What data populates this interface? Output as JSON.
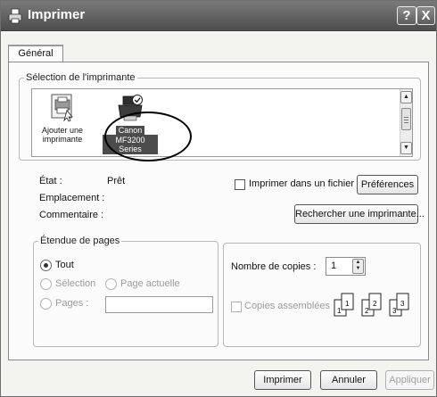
{
  "window": {
    "title": "Imprimer",
    "help_label": "?",
    "close_label": "X"
  },
  "tabs": [
    {
      "label": "Général",
      "selected": true
    }
  ],
  "printer_group": {
    "legend": "Sélection de l'imprimante",
    "items": [
      {
        "line1": "Ajouter une",
        "line2": "imprimante",
        "icon": "add-printer-icon"
      },
      {
        "line1": "Canon",
        "line2": "MF3200 Series",
        "icon": "printer-icon",
        "selected": true
      }
    ]
  },
  "info": {
    "status_label": "État :",
    "status_value": "Prêt",
    "location_label": "Emplacement :",
    "comment_label": "Commentaire :",
    "print_to_file_label": "Imprimer dans un fichier",
    "print_to_file_checked": false,
    "preferences_label": "Préférences",
    "find_printer_label": "Rechercher une imprimante..."
  },
  "page_range": {
    "legend": "Étendue de pages",
    "all_label": "Tout",
    "selection_label": "Sélection",
    "current_page_label": "Page actuelle",
    "pages_label": "Pages :",
    "pages_value": "",
    "selected": "all"
  },
  "copies": {
    "label": "Nombre de copies :",
    "value": "1",
    "collate_label": "Copies assemblées",
    "collate_checked": false,
    "collate_enabled": false
  },
  "collate_diagram": [
    "1",
    "1",
    "2",
    "2",
    "3",
    "3"
  ],
  "buttons": {
    "print": "Imprimer",
    "cancel": "Annuler",
    "apply": "Appliquer"
  }
}
